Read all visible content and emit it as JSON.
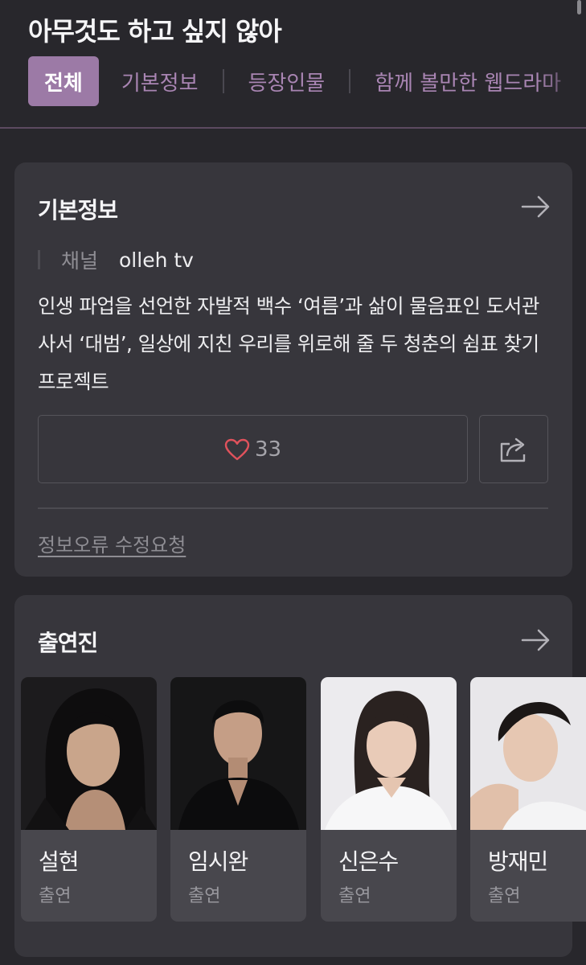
{
  "header": {
    "title": "아무것도 하고 싶지 않아",
    "tabs": [
      {
        "label": "전체",
        "active": true
      },
      {
        "label": "기본정보",
        "active": false
      },
      {
        "label": "등장인물",
        "active": false
      },
      {
        "label": "함께 볼만한 웹드라마",
        "active": false
      }
    ]
  },
  "info_card": {
    "heading": "기본정보",
    "channel_label": "채널",
    "channel_value": "olleh tv",
    "synopsis": "인생 파업을 선언한 자발적 백수 ‘여름’과 삶이 물음표인 도서관 사서 ‘대범’, 일상에 지친 우리를 위로해 줄 두 청춘의 쉼표 찾기 프로젝트",
    "like_count": "33",
    "report_label": "정보오류 수정요청"
  },
  "cast_card": {
    "heading": "출연진",
    "members": [
      {
        "name": "설현",
        "role": "출연"
      },
      {
        "name": "임시완",
        "role": "출연"
      },
      {
        "name": "신은수",
        "role": "출연"
      },
      {
        "name": "방재민",
        "role": "출연"
      }
    ]
  },
  "colors": {
    "background": "#28272c",
    "card": "#37363c",
    "accent": "#9c7aa6",
    "tab_text": "#a985b3",
    "heart": "#e0525c"
  }
}
